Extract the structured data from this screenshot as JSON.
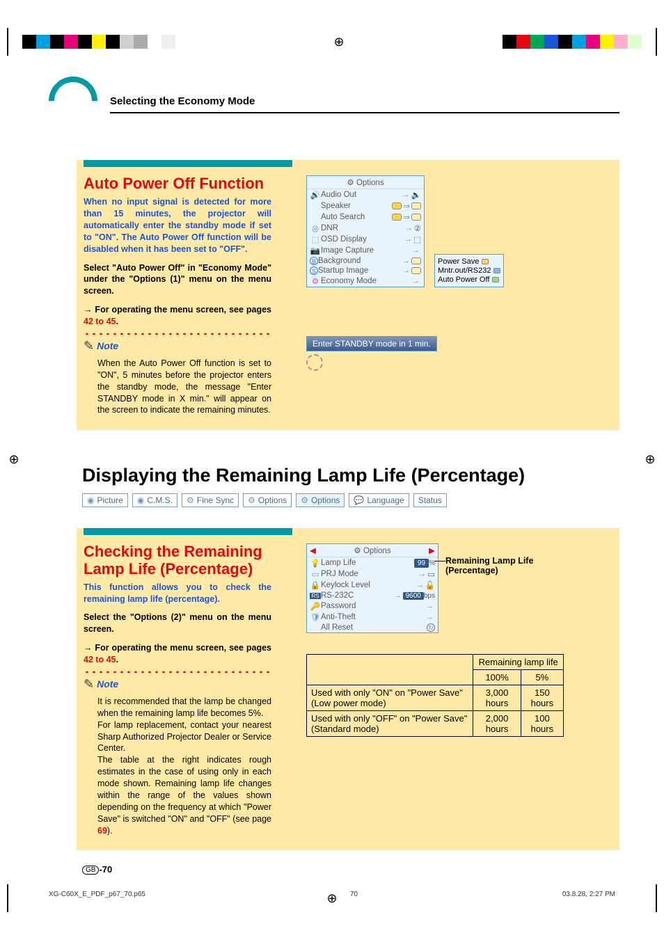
{
  "header": {
    "title": "Selecting the Economy Mode"
  },
  "section1": {
    "title": "Auto Power Off Function",
    "blue_text": "When no input signal is detected for more than 15 minutes, the projector will automatically enter the standby mode if set to \"ON\". The Auto Power Off function will be disabled when it has been set to \"OFF\".",
    "body1": "Select \"Auto Power Off\" in \"Economy Mode\" under the \"Options (1)\" menu on the menu screen.",
    "body2_prefix": "→ For operating the menu screen, see pages ",
    "body2_link": "42 to 45",
    "body2_suffix": ".",
    "note_label": "Note",
    "note_body": "When the Auto Power Off function is set to \"ON\", 5 minutes before the projector enters the standby mode, the message \"Enter STANDBY mode in X min.\" will appear on the screen to indicate the remaining minutes."
  },
  "osd1": {
    "title": "Options",
    "rows": [
      {
        "icon": "🔊",
        "label": "Audio Out",
        "suffix": ""
      },
      {
        "icon": "",
        "label": "Speaker",
        "suffix": ""
      },
      {
        "icon": "",
        "label": "Auto Search",
        "suffix": ""
      },
      {
        "icon": "⬚",
        "label": "DNR",
        "suffix": ""
      },
      {
        "icon": "⬚",
        "label": "OSD Display",
        "suffix": ""
      },
      {
        "icon": "⬚",
        "label": "Image Capture",
        "suffix": ""
      },
      {
        "icon": "B",
        "label": "Background",
        "suffix": ""
      },
      {
        "icon": "S",
        "label": "Startup Image",
        "suffix": ""
      },
      {
        "icon": "⚙",
        "label": "Economy Mode",
        "suffix": ""
      }
    ],
    "side": {
      "row1": "Power Save",
      "row2": "Mntr.out/RS232",
      "row3": "Auto Power Off"
    }
  },
  "standby_msg": "Enter STANDBY mode in 1 min.",
  "section_title2": "Displaying the Remaining Lamp Life (Percentage)",
  "tabs": [
    "Picture",
    "C.M.S.",
    "Fine Sync",
    "Options",
    "Options",
    "Language",
    "Status"
  ],
  "section2": {
    "title": "Checking the Remaining Lamp Life (Percentage)",
    "blue_text": "This function allows you to check the remaining lamp life (percentage).",
    "body1": "Select the \"Options (2)\" menu on the menu screen.",
    "body2_prefix": "→ For operating the menu screen, see pages ",
    "body2_link": "42 to 45",
    "body2_suffix": ".",
    "note_label": "Note",
    "note_body1": "It is recommended that the lamp be changed when the remaining lamp life becomes 5%.",
    "note_body2": "For lamp replacement, contact your nearest Sharp Authorized Projector Dealer or Service Center.",
    "note_body3_prefix": "The table at the right indicates rough estimates in the case of using only in each mode shown. Remaining lamp life changes within the range of the values shown depending on the frequency at which \"Power Save\" is switched \"ON\" and \"OFF\" (see page ",
    "note_body3_link": "69",
    "note_body3_suffix": ")."
  },
  "osd2": {
    "title": "Options",
    "rows": [
      {
        "icon": "💡",
        "label": "Lamp Life",
        "value": "99",
        "unit": "%"
      },
      {
        "icon": "⬚",
        "label": "PRJ Mode"
      },
      {
        "icon": "🔒",
        "label": "Keylock Level"
      },
      {
        "icon": "RS",
        "label": "RS-232C",
        "value": "9600",
        "unit": "bps"
      },
      {
        "icon": "🔑",
        "label": "Password"
      },
      {
        "icon": "🛡",
        "label": "Anti-Theft"
      },
      {
        "icon": "",
        "label": "All Reset"
      }
    ],
    "annotation": "Remaining Lamp Life (Percentage)"
  },
  "chart_data": {
    "type": "table",
    "title": "Remaining lamp life",
    "columns": [
      "",
      "100%",
      "5%"
    ],
    "rows": [
      {
        "label": "Used with only \"ON\" on \"Power Save\" (Low power mode)",
        "col100": "3,000 hours",
        "col5": "150 hours"
      },
      {
        "label": "Used with only \"OFF\" on \"Power Save\" (Standard mode)",
        "col100": "2,000 hours",
        "col5": "100 hours"
      }
    ]
  },
  "page_number": {
    "prefix": "GB",
    "num": "-70"
  },
  "footer": {
    "left": "XG-C60X_E_PDF_p67_70.p65",
    "center": "70",
    "right": "03.8.28, 2:27 PM"
  }
}
